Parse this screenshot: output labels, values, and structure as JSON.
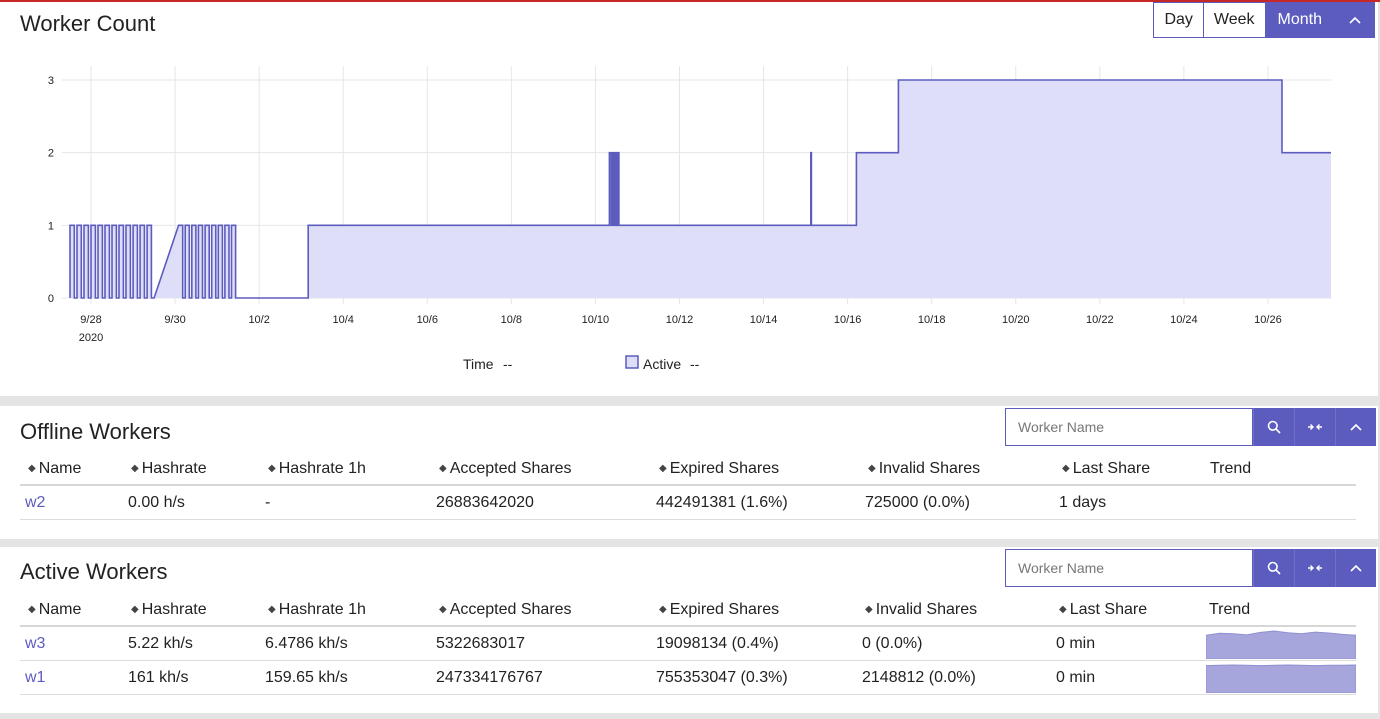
{
  "chart_panel": {
    "title": "Worker Count",
    "range_buttons": [
      "Day",
      "Week",
      "Month"
    ],
    "active_range": "Month"
  },
  "chart_data": {
    "type": "area",
    "title": "Worker Count",
    "xlabel": "",
    "ylabel": "",
    "ylim": [
      0,
      3
    ],
    "yticks": [
      "0",
      "1",
      "2",
      "3"
    ],
    "x_start": "9/27 12:00",
    "x_end": "10/27 12:00",
    "x_ticks": [
      {
        "label": "9/28",
        "sub": "2020",
        "day": 9.28
      },
      {
        "label": "9/30",
        "day": 9.3
      },
      {
        "label": "10/2",
        "day": 10.02
      },
      {
        "label": "10/4",
        "day": 10.04
      },
      {
        "label": "10/6",
        "day": 10.06
      },
      {
        "label": "10/8",
        "day": 10.08
      },
      {
        "label": "10/10",
        "day": 10.1
      },
      {
        "label": "10/12",
        "day": 10.12
      },
      {
        "label": "10/14",
        "day": 10.14
      },
      {
        "label": "10/16",
        "day": 10.16
      },
      {
        "label": "10/18",
        "day": 10.18
      },
      {
        "label": "10/20",
        "day": 10.2
      },
      {
        "label": "10/22",
        "day": 10.22
      },
      {
        "label": "10/24",
        "day": 10.24
      },
      {
        "label": "10/26",
        "day": 10.26
      }
    ],
    "series": [
      {
        "name": "Active",
        "color": "#5c5cbf",
        "fill": "#dedef8",
        "steps": [
          {
            "from": "9/27 12:00",
            "to": "9/29 12:00",
            "value": "toggling 0-1"
          },
          {
            "from": "9/30 2:00",
            "to": "10/1 12:00",
            "value": "toggling 0-1"
          },
          {
            "from": "10/1 12:00",
            "to": "10/3 4:00",
            "value": 0
          },
          {
            "from": "10/3 4:00",
            "to": "10/10 8:00",
            "value": 1
          },
          {
            "from": "10/10 8:00",
            "to": "10/10 14:00",
            "value": "toggling 1-2"
          },
          {
            "from": "10/10 14:00",
            "to": "10/15 3:00",
            "value": 1
          },
          {
            "from": "10/15 3:00",
            "to": "10/15 3:20",
            "value": 2
          },
          {
            "from": "10/15 3:20",
            "to": "10/16 5:00",
            "value": 1
          },
          {
            "from": "10/16 5:00",
            "to": "10/17 5:00",
            "value": 2
          },
          {
            "from": "10/17 5:00",
            "to": "10/26 8:00",
            "value": 3
          },
          {
            "from": "10/26 8:00",
            "to": "10/27 12:00",
            "value": 2
          }
        ]
      }
    ],
    "legend": {
      "time_label": "Time",
      "time_value": "--",
      "series_label": "Active",
      "series_value": "--"
    },
    "grid": true
  },
  "offline": {
    "title": "Offline Workers",
    "search_placeholder": "Worker Name",
    "columns": [
      "Name",
      "Hashrate",
      "Hashrate 1h",
      "Accepted Shares",
      "Expired Shares",
      "Invalid Shares",
      "Last Share",
      "Trend"
    ],
    "rows": [
      {
        "name": "w2",
        "hashrate": "0.00 h/s",
        "hashrate_1h": "-",
        "accepted": "26883642020",
        "expired": "442491381 (1.6%)",
        "invalid": "725000 (0.0%)",
        "last_share": "1 days",
        "trend": ""
      }
    ]
  },
  "active": {
    "title": "Active Workers",
    "search_placeholder": "Worker Name",
    "columns": [
      "Name",
      "Hashrate",
      "Hashrate 1h",
      "Accepted Shares",
      "Expired Shares",
      "Invalid Shares",
      "Last Share",
      "Trend"
    ],
    "rows": [
      {
        "name": "w3",
        "hashrate": "5.22 kh/s",
        "hashrate_1h": "6.4786 kh/s",
        "accepted": "5322683017",
        "expired": "19098134 (0.4%)",
        "invalid": "0 (0.0%)",
        "last_share": "0 min",
        "trend": [
          0.85,
          0.92,
          0.9,
          0.86,
          0.95,
          1.0,
          0.94,
          0.9,
          0.96,
          0.93,
          0.88,
          0.85
        ]
      },
      {
        "name": "w1",
        "hashrate": "161 kh/s",
        "hashrate_1h": "159.65 kh/s",
        "accepted": "247334176767",
        "expired": "755353047 (0.3%)",
        "invalid": "2148812 (0.0%)",
        "last_share": "0 min",
        "trend": [
          0.98,
          0.99,
          1.0,
          0.99,
          0.98,
          0.99,
          1.0,
          0.99,
          0.98,
          0.99,
          0.99,
          1.0
        ]
      }
    ]
  }
}
